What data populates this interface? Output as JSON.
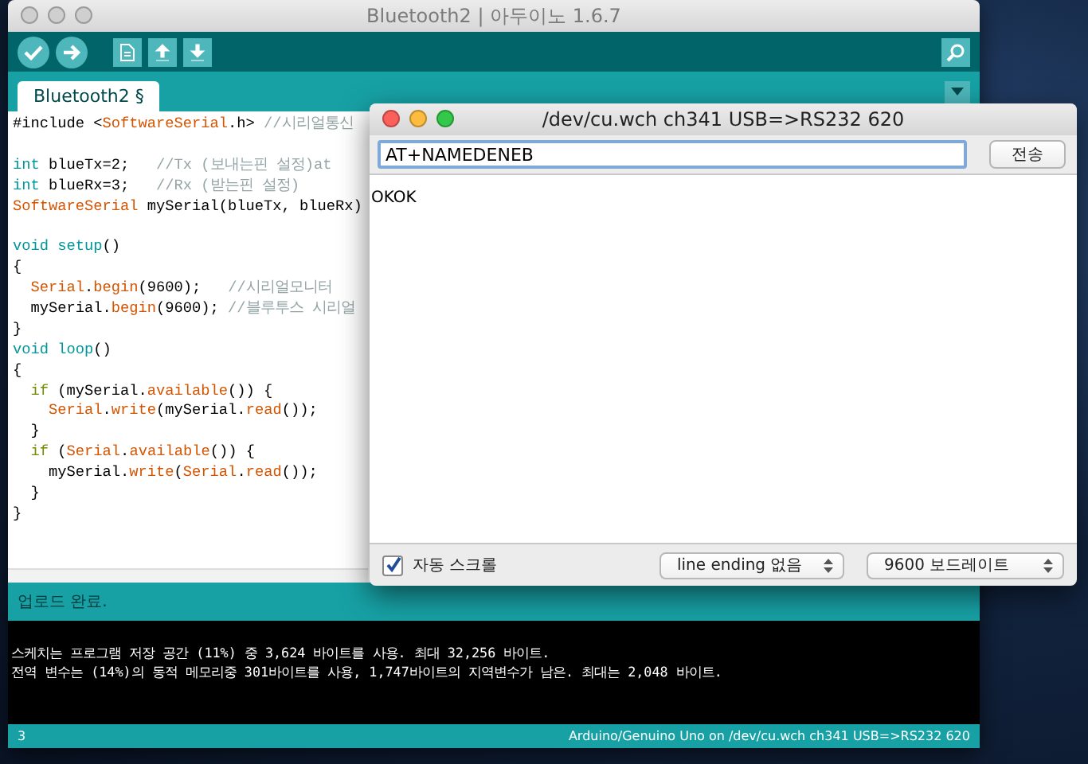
{
  "window": {
    "title": "Bluetooth2 | 아두이노 1.6.7"
  },
  "tabs": [
    {
      "label": "Bluetooth2 §",
      "selected": true
    }
  ],
  "editor": {
    "lines": [
      {
        "kind": "code",
        "segments": [
          {
            "kind": "plain",
            "text": "#include <"
          },
          {
            "kind": "type",
            "text": "SoftwareSerial"
          },
          {
            "kind": "plain",
            "text": ".h> "
          },
          {
            "kind": "comment",
            "text": "//시리얼통신"
          }
        ]
      },
      {
        "kind": "blank"
      },
      {
        "kind": "code",
        "segments": [
          {
            "kind": "keyword",
            "text": "int"
          },
          {
            "kind": "plain",
            "text": " blueTx=2;   "
          },
          {
            "kind": "comment",
            "text": "//Tx (보내는핀 설정)at"
          }
        ]
      },
      {
        "kind": "code",
        "segments": [
          {
            "kind": "keyword",
            "text": "int"
          },
          {
            "kind": "plain",
            "text": " blueRx=3;   "
          },
          {
            "kind": "comment",
            "text": "//Rx (받는핀 설정)"
          }
        ]
      },
      {
        "kind": "code",
        "segments": [
          {
            "kind": "type",
            "text": "SoftwareSerial"
          },
          {
            "kind": "plain",
            "text": " mySerial(blueTx, blueRx)"
          }
        ]
      },
      {
        "kind": "blank"
      },
      {
        "kind": "code",
        "segments": [
          {
            "kind": "keyword",
            "text": "void setup"
          },
          {
            "kind": "plain",
            "text": "()"
          }
        ]
      },
      {
        "kind": "code",
        "segments": [
          {
            "kind": "plain",
            "text": "{"
          }
        ]
      },
      {
        "kind": "code",
        "segments": [
          {
            "kind": "type",
            "text": "  Serial"
          },
          {
            "kind": "plain",
            "text": "."
          },
          {
            "kind": "function",
            "text": "begin"
          },
          {
            "kind": "plain",
            "text": "(9600);   "
          },
          {
            "kind": "comment",
            "text": "//시리얼모니터"
          }
        ]
      },
      {
        "kind": "code",
        "segments": [
          {
            "kind": "plain",
            "text": "  mySerial."
          },
          {
            "kind": "function",
            "text": "begin"
          },
          {
            "kind": "plain",
            "text": "(9600); "
          },
          {
            "kind": "comment",
            "text": "//블루투스 시리얼"
          }
        ]
      },
      {
        "kind": "code",
        "segments": [
          {
            "kind": "plain",
            "text": "}"
          }
        ]
      },
      {
        "kind": "code",
        "segments": [
          {
            "kind": "keyword",
            "text": "void loop"
          },
          {
            "kind": "plain",
            "text": "()"
          }
        ]
      },
      {
        "kind": "code",
        "segments": [
          {
            "kind": "plain",
            "text": "{"
          }
        ]
      },
      {
        "kind": "code",
        "segments": [
          {
            "kind": "control",
            "text": "  if"
          },
          {
            "kind": "plain",
            "text": " (mySerial."
          },
          {
            "kind": "function",
            "text": "available"
          },
          {
            "kind": "plain",
            "text": "()) {"
          }
        ]
      },
      {
        "kind": "code",
        "segments": [
          {
            "kind": "type",
            "text": "    Serial"
          },
          {
            "kind": "plain",
            "text": "."
          },
          {
            "kind": "function",
            "text": "write"
          },
          {
            "kind": "plain",
            "text": "(mySerial."
          },
          {
            "kind": "function",
            "text": "read"
          },
          {
            "kind": "plain",
            "text": "());"
          }
        ]
      },
      {
        "kind": "code",
        "segments": [
          {
            "kind": "plain",
            "text": "  }"
          }
        ]
      },
      {
        "kind": "code",
        "segments": [
          {
            "kind": "control",
            "text": "  if"
          },
          {
            "kind": "plain",
            "text": " ("
          },
          {
            "kind": "type",
            "text": "Serial"
          },
          {
            "kind": "plain",
            "text": "."
          },
          {
            "kind": "function",
            "text": "available"
          },
          {
            "kind": "plain",
            "text": "()) {"
          }
        ]
      },
      {
        "kind": "code",
        "segments": [
          {
            "kind": "plain",
            "text": "    mySerial."
          },
          {
            "kind": "function",
            "text": "write"
          },
          {
            "kind": "plain",
            "text": "("
          },
          {
            "kind": "type",
            "text": "Serial"
          },
          {
            "kind": "plain",
            "text": "."
          },
          {
            "kind": "function",
            "text": "read"
          },
          {
            "kind": "plain",
            "text": "());"
          }
        ]
      },
      {
        "kind": "code",
        "segments": [
          {
            "kind": "plain",
            "text": "  }"
          }
        ]
      },
      {
        "kind": "code",
        "segments": [
          {
            "kind": "plain",
            "text": "}"
          }
        ]
      }
    ]
  },
  "status_message": "업로드 완료.",
  "console": {
    "lines": [
      "스케치는 프로그램 저장 공간 (11%) 중 3,624 바이트를 사용. 최대 32,256 바이트.",
      "전역 변수는 (14%)의 동적 메모리중 301바이트를 사용, 1,747바이트의 지역변수가 남은. 최대는 2,048 바이트."
    ]
  },
  "status_bar": {
    "line": "3",
    "board": "Arduino/Genuino Uno on /dev/cu.wch ch341 USB=>RS232 620"
  },
  "serial_monitor": {
    "title": "/dev/cu.wch ch341 USB=>RS232 620",
    "input": {
      "value": "AT+NAMEDENEB"
    },
    "send_button": "전송",
    "output": "OKOK",
    "autoscroll": {
      "label": "자동 스크롤",
      "checked": true
    },
    "line_ending": "line ending 없음",
    "baud": "9600 보드레이트"
  }
}
